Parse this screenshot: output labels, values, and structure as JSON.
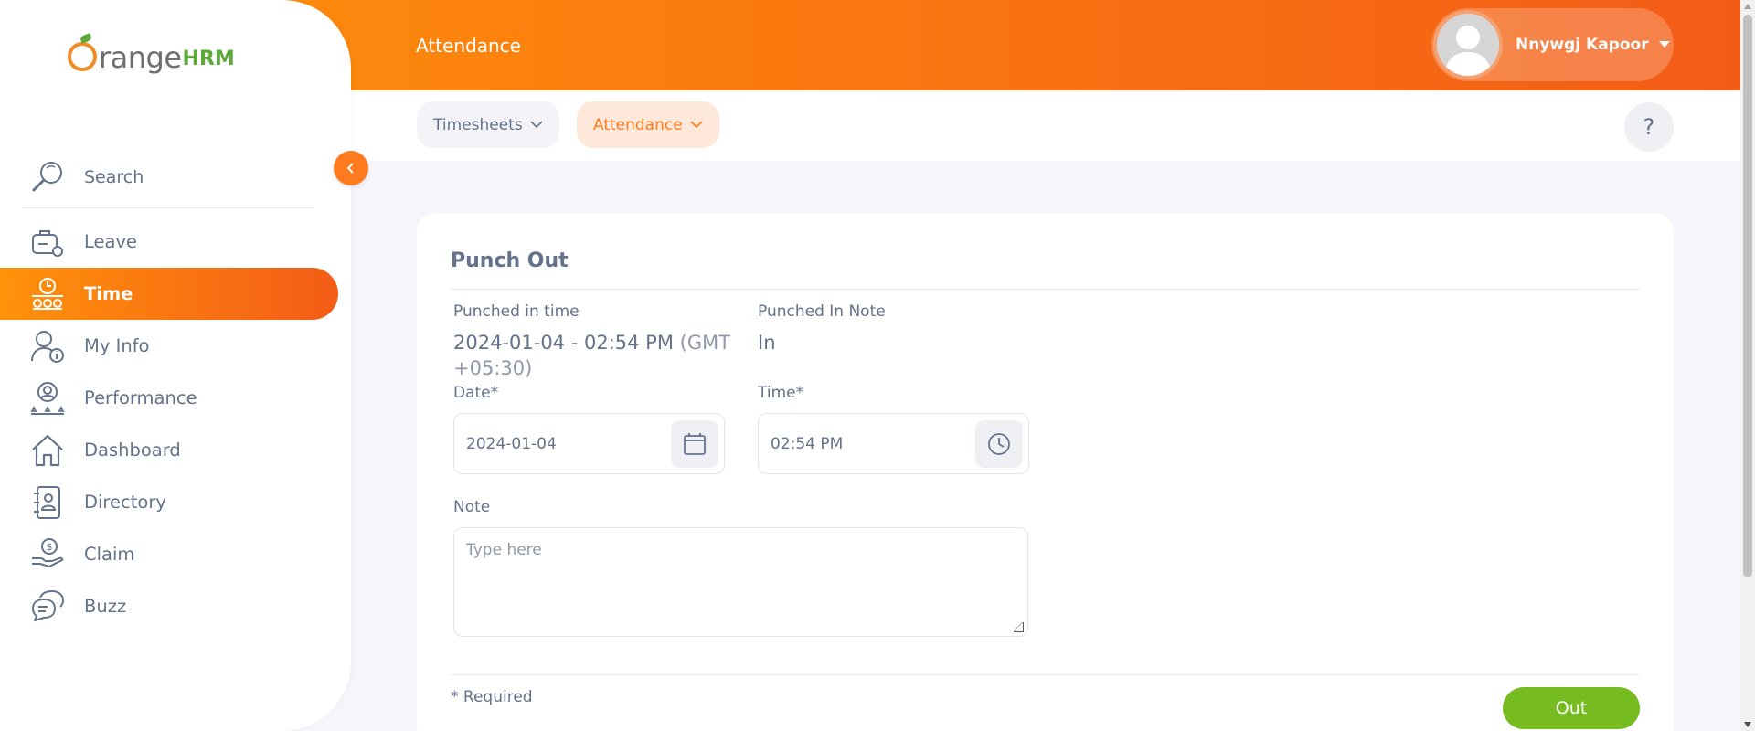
{
  "app": {
    "brand": {
      "part_a": "range",
      "part_b": "HRM"
    },
    "brand_colors": {
      "orange": "#f28c28",
      "green": "#5cab3a"
    }
  },
  "colors": {
    "header_gradient_start": "#ff920b",
    "header_gradient_end": "#f35c17",
    "accent": "#ff7b1d",
    "text": "#64728c",
    "success_button": "#76bc21"
  },
  "sidebar": {
    "search_label": "Search",
    "items": [
      {
        "label": "Leave",
        "icon": "leave-icon",
        "active": false
      },
      {
        "label": "Time",
        "icon": "time-icon",
        "active": true
      },
      {
        "label": "My Info",
        "icon": "my-info-icon",
        "active": false
      },
      {
        "label": "Performance",
        "icon": "performance-icon",
        "active": false
      },
      {
        "label": "Dashboard",
        "icon": "dashboard-icon",
        "active": false
      },
      {
        "label": "Directory",
        "icon": "directory-icon",
        "active": false
      },
      {
        "label": "Claim",
        "icon": "claim-icon",
        "active": false
      },
      {
        "label": "Buzz",
        "icon": "buzz-icon",
        "active": false
      }
    ]
  },
  "header": {
    "title": "Attendance",
    "user_name": "Nnywgj Kapoor"
  },
  "subnav": {
    "tabs": [
      {
        "label": "Timesheets",
        "active": false
      },
      {
        "label": "Attendance",
        "active": true
      }
    ],
    "help_label": "?"
  },
  "form": {
    "title": "Punch Out",
    "punched_in_time_label": "Punched in time",
    "punched_in_time_value": "2024-01-04 - 02:54 PM",
    "punched_in_timezone": "(GMT +05:30)",
    "punched_in_note_label": "Punched In Note",
    "punched_in_note_value": "In",
    "date_label": "Date*",
    "date_value": "2024-01-04",
    "time_label": "Time*",
    "time_value": "02:54 PM",
    "note_label": "Note",
    "note_placeholder": "Type here",
    "required_text": "* Required",
    "submit_label": "Out"
  }
}
